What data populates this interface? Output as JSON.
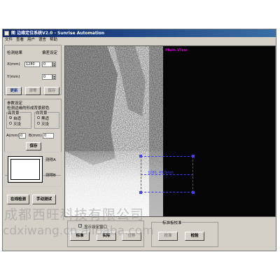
{
  "window": {
    "title": "图 边缘定位系统V2.0 - Sunrise Automation"
  },
  "menu": [
    "文件",
    "查看",
    "用户",
    "语言",
    "帮助"
  ],
  "measure": {
    "section_label": "检测结果",
    "offset_label": "偏差设定",
    "x_label": "X(mm)",
    "x_value": "1280",
    "x_offset": "0",
    "y_label": "Y(mm)",
    "y_offset": "0"
  },
  "actions": {
    "update": "更新",
    "clear": "清零",
    "save_disabled": "保存"
  },
  "params": {
    "section_label": "参数设定",
    "desc": "检测边缘的形成背景颜色",
    "left_group": "高背景",
    "left_auto": "自适",
    "left_black": "灭设",
    "right_group": "白背景",
    "right_auto": "黑适",
    "right_black": "灭设",
    "a_label": "A(mm)",
    "a_value": "0",
    "b_label": "B(mm)",
    "b_value": "0",
    "save": "保存"
  },
  "diagram": {
    "a_label": "测得A",
    "b_label": "测得B"
  },
  "bottom_left": {
    "online": "在线检测",
    "manual": "手动测试"
  },
  "image": {
    "label": "Main View",
    "roi_readout": "1280, 40.0mm"
  },
  "bottom": {
    "checkbox_label": "显示设定窗口",
    "checked": true,
    "calibrate": "标准",
    "actual": "实际",
    "disabled_btn": "位移",
    "std_group": "标准板校准",
    "std_btn": "校准",
    "check": "检验"
  },
  "watermark": {
    "line1": "成都西旺科技有限公司",
    "line2": "cdxiwang.cn.alibaba.com"
  },
  "colors": {
    "title_bar": "#0a246a",
    "main_view_label": "#c000c0",
    "roi": "#4040ff"
  }
}
